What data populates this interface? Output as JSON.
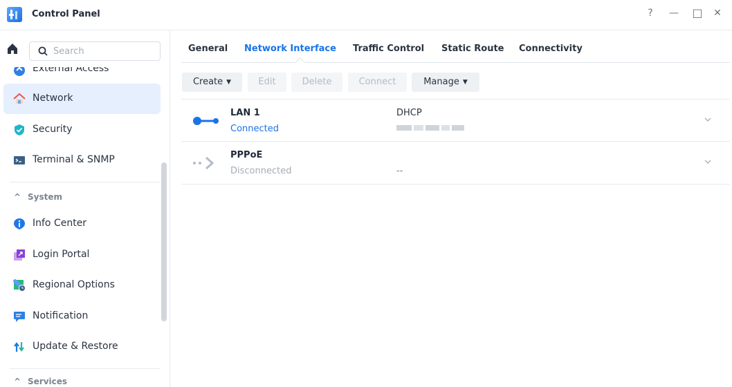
{
  "window": {
    "title": "Control Panel",
    "controls": {
      "help": "?",
      "minimize": "—",
      "maximize": "□",
      "close": "✕"
    }
  },
  "sidebar": {
    "search_placeholder": "Search",
    "items": [
      {
        "label": "External Access",
        "icon": "external-access-icon"
      },
      {
        "label": "Network",
        "icon": "house-network-icon",
        "active": true
      },
      {
        "label": "Security",
        "icon": "shield-check-icon"
      },
      {
        "label": "Terminal & SNMP",
        "icon": "terminal-icon"
      },
      {
        "label": "Info Center",
        "icon": "info-icon"
      },
      {
        "label": "Login Portal",
        "icon": "login-portal-icon"
      },
      {
        "label": "Regional Options",
        "icon": "regional-options-icon"
      },
      {
        "label": "Notification",
        "icon": "notification-icon"
      },
      {
        "label": "Update & Restore",
        "icon": "update-restore-icon"
      }
    ],
    "sections": {
      "system": "System",
      "services": "Services"
    }
  },
  "tabs": [
    {
      "label": "General"
    },
    {
      "label": "Network Interface",
      "active": true
    },
    {
      "label": "Traffic Control"
    },
    {
      "label": "Static Route"
    },
    {
      "label": "Connectivity"
    }
  ],
  "toolbar": {
    "create": "Create",
    "edit": "Edit",
    "delete": "Delete",
    "connect": "Connect",
    "manage": "Manage"
  },
  "interfaces": [
    {
      "name": "LAN 1",
      "status": "Connected",
      "protocol": "DHCP",
      "address": "",
      "address_redacted": true
    },
    {
      "name": "PPPoE",
      "status": "Disconnected",
      "protocol": "",
      "address": "--"
    }
  ],
  "colors": {
    "accent": "#1a73e8",
    "active_bg": "#e5effd",
    "text": "#2a3441",
    "muted": "#a5acb5"
  }
}
